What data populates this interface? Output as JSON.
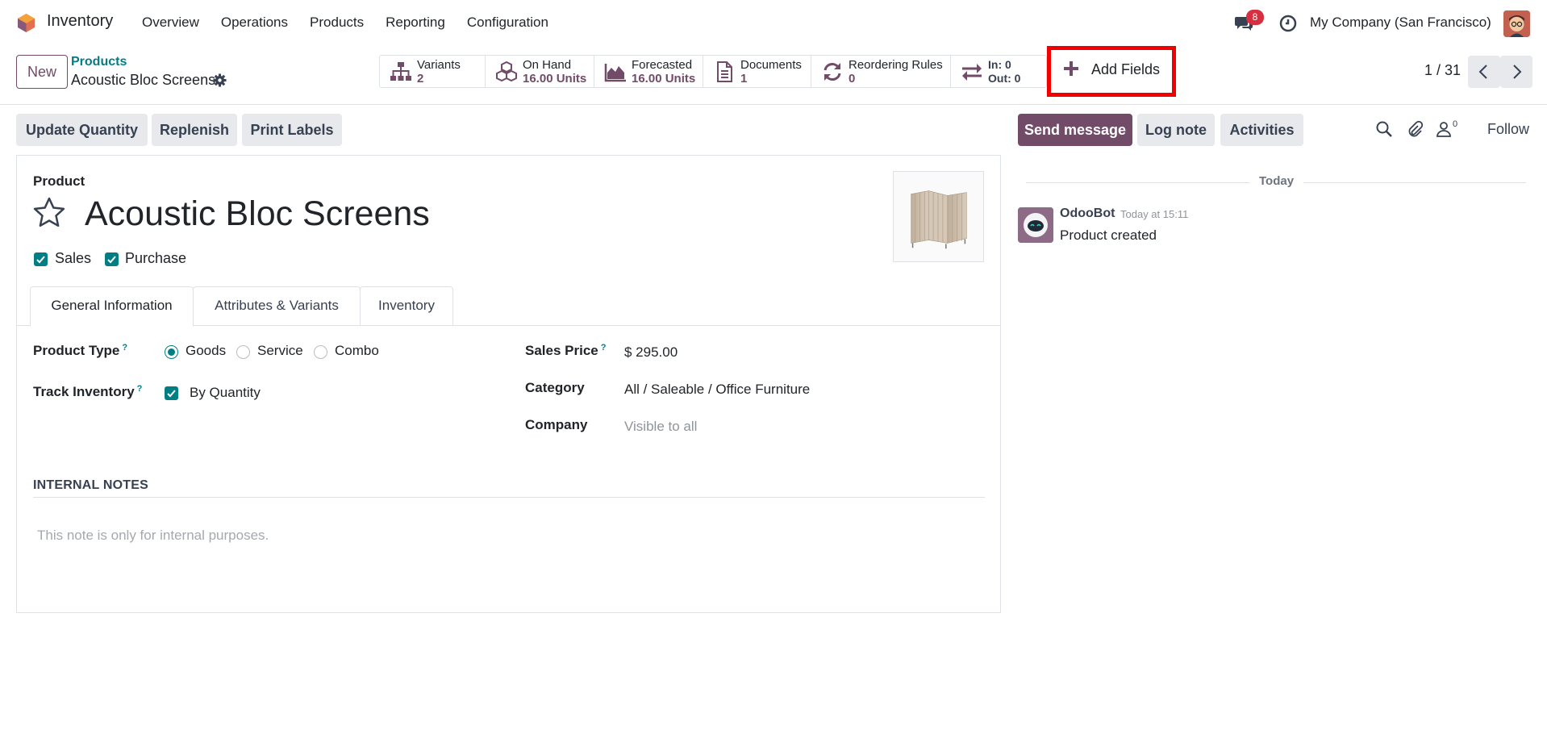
{
  "navbar": {
    "app_name": "Inventory",
    "menu": [
      "Overview",
      "Operations",
      "Products",
      "Reporting",
      "Configuration"
    ],
    "message_count": "8",
    "company": "My Company (San Francisco)"
  },
  "control": {
    "new_label": "New",
    "breadcrumb_parent": "Products",
    "breadcrumb_current": "Acoustic Bloc Screens",
    "smart_buttons": [
      {
        "label": "Variants",
        "value": "2",
        "icon": "sitemap-icon"
      },
      {
        "label": "On Hand",
        "value": "16.00 Units",
        "icon": "cubes-icon"
      },
      {
        "label": "Forecasted",
        "value": "16.00 Units",
        "icon": "area-chart-icon"
      },
      {
        "label": "Documents",
        "value": "1",
        "icon": "document-icon"
      },
      {
        "label": "Reordering Rules",
        "value": "0",
        "icon": "refresh-icon"
      },
      {
        "label": "In: 0",
        "value": "Out: 0",
        "icon": "exchange-icon"
      }
    ],
    "add_fields_label": "Add Fields",
    "pager": "1 / 31"
  },
  "actions": {
    "update_quantity": "Update Quantity",
    "replenish": "Replenish",
    "print_labels": "Print Labels"
  },
  "chatter": {
    "send_message": "Send message",
    "log_note": "Log note",
    "activities": "Activities",
    "follower_count": "0",
    "follow": "Follow",
    "day": "Today",
    "author": "OdooBot",
    "time": "Today at 15:11",
    "body": "Product created"
  },
  "form": {
    "product_label": "Product",
    "name": "Acoustic Bloc Screens",
    "sales_label": "Sales",
    "purchase_label": "Purchase",
    "tabs": [
      "General Information",
      "Attributes & Variants",
      "Inventory"
    ],
    "product_type_label": "Product Type",
    "product_type_options": [
      "Goods",
      "Service",
      "Combo"
    ],
    "product_type_selected": "Goods",
    "track_inventory_label": "Track Inventory",
    "track_inventory_value": "By Quantity",
    "sales_price_label": "Sales Price",
    "sales_price": "$ 295.00",
    "category_label": "Category",
    "category": "All / Saleable / Office Furniture",
    "company_label": "Company",
    "company_placeholder": "Visible to all",
    "help_mark": "?",
    "notes_heading": "INTERNAL NOTES",
    "notes_placeholder": "This note is only for internal purposes."
  },
  "colors": {
    "primary": "#714b67",
    "accent": "#017e84",
    "highlight": "#f20000",
    "badge": "#d62f3f"
  }
}
